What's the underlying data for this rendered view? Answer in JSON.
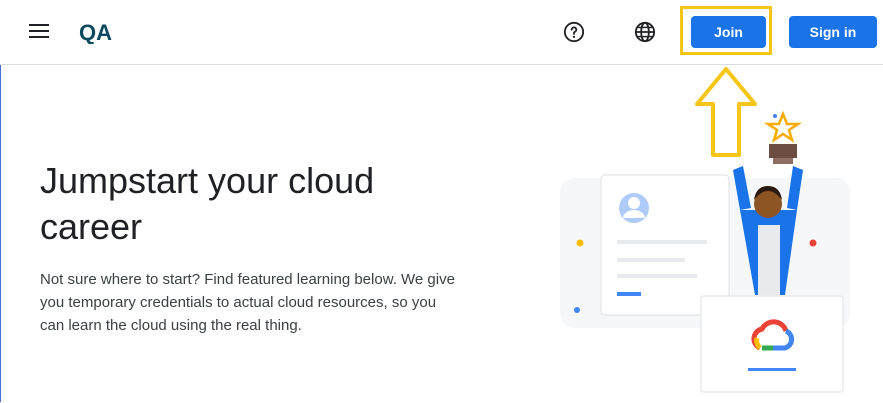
{
  "header": {
    "join_label": "Join",
    "signin_label": "Sign in",
    "logo_text": "QA",
    "icons": [
      "menu-icon",
      "help-icon",
      "globe-icon"
    ]
  },
  "hero": {
    "title": "Jumpstart your cloud career",
    "description": "Not sure where to start? Find featured learning below. We give you temporary credentials to actual cloud resources, so you can learn the cloud using the real thing."
  },
  "colors": {
    "accent": "#1a73e8",
    "highlight": "#f5c518",
    "logo": "#0b4a5e"
  }
}
